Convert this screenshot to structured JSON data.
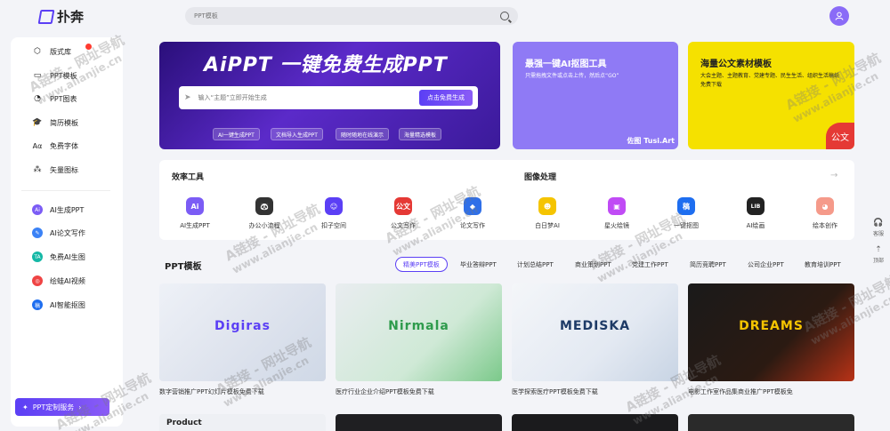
{
  "header": {
    "logo_text": "扑奔",
    "search_placeholder": "PPT模板",
    "avatar_icon": "user-icon"
  },
  "sidebar": {
    "items": [
      {
        "label": "版式库",
        "icon": "cube-icon"
      },
      {
        "label": "PPT模板",
        "icon": "monitor-icon"
      },
      {
        "label": "PPT图表",
        "icon": "chart-icon"
      },
      {
        "label": "简历模板",
        "icon": "graduation-cap-icon"
      },
      {
        "label": "免费字体",
        "icon": "font-icon"
      },
      {
        "label": "矢量图标",
        "icon": "shapes-icon"
      },
      {
        "label": "AI生成PPT",
        "icon": "ai-ppt-icon"
      },
      {
        "label": "AI论文写作",
        "icon": "ai-write-icon"
      },
      {
        "label": "免费AI生图",
        "icon": "ta-icon"
      },
      {
        "label": "绘蛙AI视频",
        "icon": "frog-icon"
      },
      {
        "label": "AI智能抠图",
        "icon": "cutout-icon"
      }
    ],
    "custom_button": "PPT定制服务"
  },
  "hero": {
    "title": "AiPPT 一键免费生成PPT",
    "input_placeholder": "输入“主题”立即开始生成",
    "button": "点击免费生成",
    "chips": [
      "AI一键生成PPT",
      "文档导入生成PPT",
      "随时随地在线演示",
      "海量精选模板"
    ]
  },
  "promo_cards": [
    {
      "title": "最强一键AI抠图工具",
      "desc": "只需拖拽文件或点击上传，然后点“GO”",
      "badge": "佐图 Tusi.Art"
    },
    {
      "title": "海量公文素材模板",
      "desc": "大会主题、主题教育、党建专题、民生生活、组织生活稿纸免费下载",
      "badge": "公文"
    }
  ],
  "tools": {
    "efficiency_title": "效率工具",
    "image_title": "图像处理",
    "efficiency": [
      {
        "label": "AI生成PPT",
        "color": "#7b5cf5",
        "glyph": "Ai"
      },
      {
        "label": "办公小流程",
        "color": "#333333",
        "glyph": "🐼"
      },
      {
        "label": "扣子空间",
        "color": "#5b3ff5",
        "glyph": "☺"
      },
      {
        "label": "公文写作",
        "color": "#e53935",
        "glyph": "公文"
      },
      {
        "label": "论文写作",
        "color": "#2f6fe8",
        "glyph": "◆"
      }
    ],
    "image": [
      {
        "label": "白日梦AI",
        "color": "#f5c400",
        "glyph": "☻"
      },
      {
        "label": "星火绘镜",
        "color": "#c04bf5",
        "glyph": "▣"
      },
      {
        "label": "一键抠图",
        "color": "#1e6ef0",
        "glyph": "稿"
      },
      {
        "label": "AI绘画",
        "color": "#222222",
        "glyph": "LIB"
      },
      {
        "label": "绘本创作",
        "color": "#f59a8a",
        "glyph": "◕"
      }
    ]
  },
  "ppt_section": {
    "title": "PPT模板",
    "tabs": [
      "精美PPT模板",
      "毕业答辩PPT",
      "计划总结PPT",
      "商业策划PPT",
      "党建工作PPT",
      "简历竞聘PPT",
      "公司企业PPT",
      "教育培训PPT"
    ],
    "items": [
      {
        "caption": "数字营销推广PPT幻灯片模板免费下载",
        "thumb_text": "Digiras"
      },
      {
        "caption": "医疗行业企业介绍PPT模板免费下载",
        "thumb_text": "Nirmala"
      },
      {
        "caption": "医学探索医疗PPT模板免费下载",
        "thumb_text": "MEDISKA"
      },
      {
        "caption": "电影工作室作品集商业推广PPT模板免",
        "thumb_text": "DREAMS"
      }
    ],
    "second_row": [
      "Product",
      "",
      "",
      ""
    ]
  },
  "float_bar": {
    "service_label": "客服",
    "top_label": "顶部"
  },
  "watermark": {
    "text": "A链接 - 网址导航",
    "url": "www.alianjie.cn"
  },
  "colors": {
    "accent": "#5b3ff5",
    "promo_purple": "#8f7af5",
    "promo_yellow": "#f5e100"
  }
}
